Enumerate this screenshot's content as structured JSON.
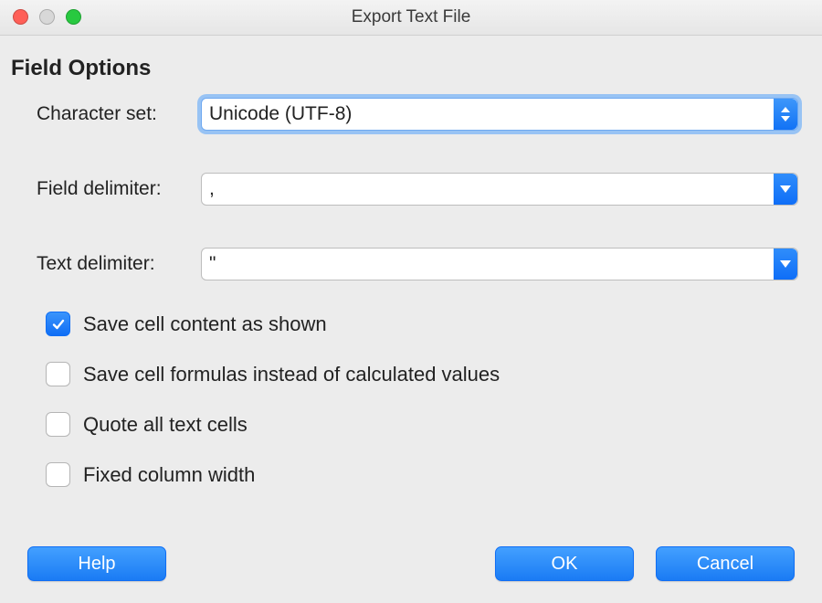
{
  "window": {
    "title": "Export Text File"
  },
  "section": {
    "title": "Field Options"
  },
  "fields": {
    "charset": {
      "label": "Character set:",
      "value": "Unicode (UTF-8)"
    },
    "fieldDelim": {
      "label": "Field delimiter:",
      "value": ","
    },
    "textDelim": {
      "label": "Text delimiter:",
      "value": "\""
    }
  },
  "checks": {
    "saveAsShown": {
      "label": "Save cell content as shown",
      "checked": true
    },
    "saveFormulas": {
      "label": "Save cell formulas instead of calculated values",
      "checked": false
    },
    "quoteAll": {
      "label": "Quote all text cells",
      "checked": false
    },
    "fixedWidth": {
      "label": "Fixed column width",
      "checked": false
    }
  },
  "buttons": {
    "help": "Help",
    "ok": "OK",
    "cancel": "Cancel"
  }
}
